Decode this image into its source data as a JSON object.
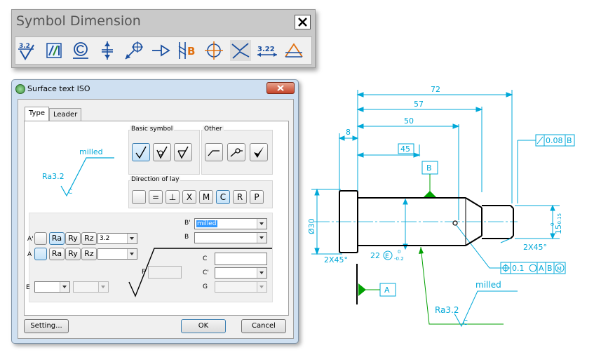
{
  "toolbar": {
    "title": "Symbol Dimension",
    "close_label": "✕",
    "tools": [
      {
        "name": "surface-symbol-tool-icon",
        "text": "3.2"
      },
      {
        "name": "weld-symbol-tool-icon",
        "text": ""
      },
      {
        "name": "center-hole-symbol-tool-icon",
        "text": ""
      },
      {
        "name": "datum-target-tool-icon",
        "text": ""
      },
      {
        "name": "leader-target-tool-icon",
        "text": ""
      },
      {
        "name": "datum-identifier-tool-icon",
        "text": ""
      },
      {
        "name": "hatch-label-tool-icon",
        "text": "B"
      },
      {
        "name": "center-mark-tool-icon",
        "text": ""
      },
      {
        "name": "cut-symbol-tool-icon",
        "text": ""
      },
      {
        "name": "dimension-number-tool-icon",
        "text": "3.22"
      },
      {
        "name": "taper-symbol-tool-icon",
        "text": ""
      }
    ]
  },
  "dialog": {
    "title": "Surface text ISO",
    "tabs": [
      "Type",
      "Leader"
    ],
    "preview": {
      "roughness": "Ra3.2",
      "text": "milled",
      "lay": "C"
    },
    "basic_symbol_label": "Basic symbol",
    "other_label": "Other",
    "direction_label": "Direction of lay",
    "lay_buttons": [
      "",
      "=",
      "⊥",
      "X",
      "M",
      "C",
      "R",
      "P"
    ],
    "row_a_prime": {
      "label": "A'",
      "params": [
        "Ra",
        "Ry",
        "Rz"
      ],
      "value": "3.2"
    },
    "row_a": {
      "label": "A",
      "params": [
        "Ra",
        "Ry",
        "Rz"
      ],
      "value": ""
    },
    "field_b_prime": {
      "label": "B'",
      "value": "milled"
    },
    "field_b": {
      "label": "B",
      "value": ""
    },
    "field_c": {
      "label": "C",
      "value": ""
    },
    "field_c_prime": {
      "label": "C'",
      "value": ""
    },
    "field_f": {
      "label": "F",
      "value": ""
    },
    "field_g": {
      "label": "G",
      "value": ""
    },
    "field_e": {
      "label": "E",
      "value": ""
    },
    "buttons": {
      "setting": "Setting...",
      "ok": "OK",
      "cancel": "Cancel"
    }
  },
  "drawing": {
    "dims": {
      "d72": "72",
      "d57": "57",
      "d50": "50",
      "d45": "45",
      "d8": "8",
      "dia30": "Ø30",
      "d15": "15",
      "d15_tol_upper": "0",
      "d15_tol_lower": "-0.15",
      "chamfer_left": "2X45°",
      "chamfer_right": "2X45°",
      "d22": "22",
      "d22_tol_upper": "0",
      "d22_tol_lower": "-0.2"
    },
    "datum_b": "B",
    "datum_a": "A",
    "runout": {
      "tolerance": "0.08",
      "datum": "B"
    },
    "position": {
      "tolerance": "0.1",
      "ref1": "A",
      "ref2": "B"
    },
    "envelope": "E",
    "surface": {
      "text": "milled",
      "roughness": "Ra3.2",
      "lay": "C"
    },
    "colors": {
      "dimension": "#00a8d8",
      "part": "#000000",
      "leader": "#00a000",
      "datum": "#00a000"
    }
  }
}
